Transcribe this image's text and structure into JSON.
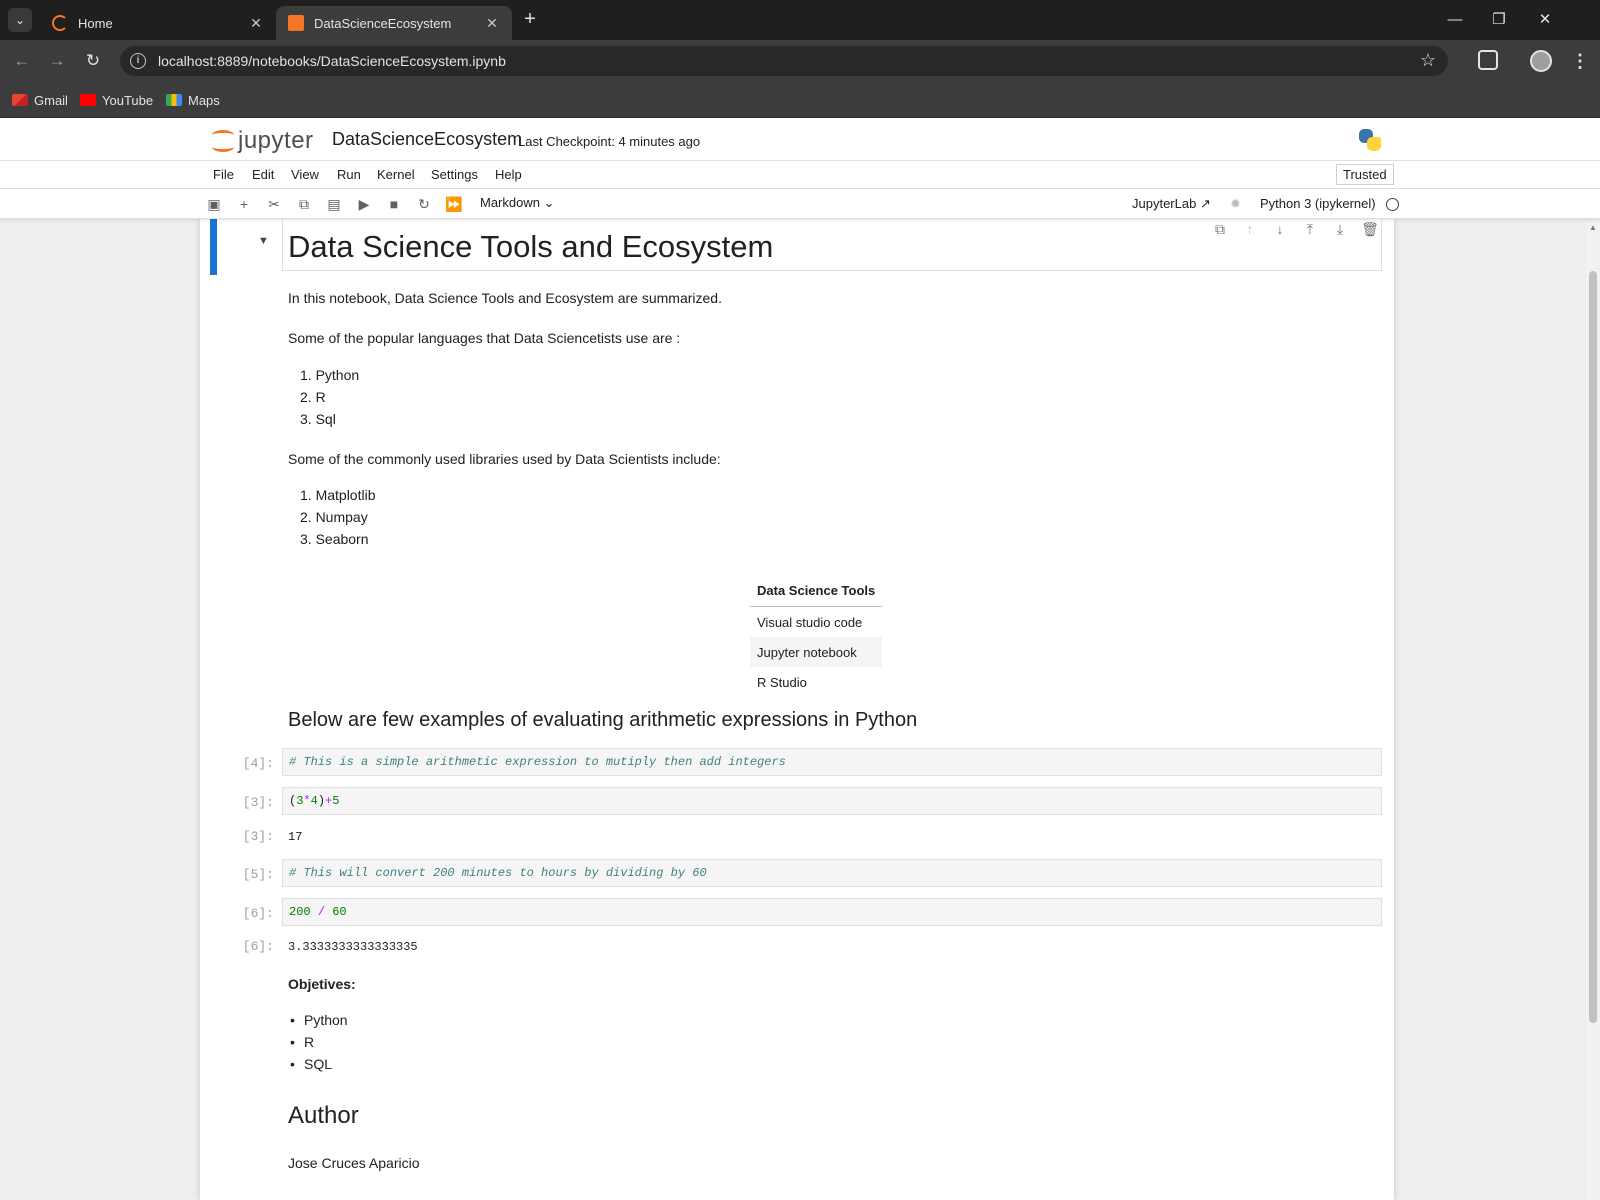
{
  "browser": {
    "tabs": [
      {
        "title": "Home",
        "active": false
      },
      {
        "title": "DataScienceEcosystem",
        "active": true
      }
    ],
    "url": "localhost:8889/notebooks/DataScienceEcosystem.ipynb",
    "bookmarks": [
      "Gmail",
      "YouTube",
      "Maps"
    ]
  },
  "jupyter": {
    "logo_text": "jupyter",
    "notebook_title": "DataScienceEcosystem",
    "checkpoint": "Last Checkpoint: 4 minutes ago",
    "menu": [
      "File",
      "Edit",
      "View",
      "Run",
      "Kernel",
      "Settings",
      "Help"
    ],
    "trusted": "Trusted",
    "cell_type": "Markdown",
    "jupyterlab_link": "JupyterLab",
    "kernel": "Python 3 (ipykernel)"
  },
  "notebook": {
    "title": "Data Science Tools and Ecosystem",
    "intro": "In this notebook, Data Science Tools and Ecosystem are summarized.",
    "languages_intro": "Some of the popular languages that Data Sciencetists use are :",
    "languages": [
      "1. Python",
      "2. R",
      "3. Sql"
    ],
    "libraries_intro": "Some of the commonly used libraries used by Data Scientists include:",
    "libraries": [
      "1. Matplotlib",
      "2. Numpay",
      "3. Seaborn"
    ],
    "tools_table": {
      "header": "Data Science Tools",
      "rows": [
        "Visual studio code",
        "Jupyter notebook",
        "R Studio"
      ]
    },
    "arith_heading": "Below are few examples of evaluating arithmetic expressions in Python",
    "cells": [
      {
        "prompt": "[4]:",
        "code": "# This is a simple arithmetic expression to mutiply then add integers"
      },
      {
        "prompt": "[3]:",
        "code": "(3*4)+5"
      },
      {
        "prompt": "[3]:",
        "output": "17"
      },
      {
        "prompt": "[5]:",
        "code": "# This will convert 200 minutes to hours by dividing by 60"
      },
      {
        "prompt": "[6]:",
        "code": "200 / 60"
      },
      {
        "prompt": "[6]:",
        "output": "3.3333333333333335"
      }
    ],
    "objectives_label": "Objetives:",
    "objectives": [
      "Python",
      "R",
      "SQL"
    ],
    "author_heading": "Author",
    "author_name": "Jose Cruces Aparicio"
  },
  "colors": {
    "jupyter_orange": "#f37726",
    "active_cell_blue": "#1976d2",
    "comment_teal": "#408080",
    "number_green": "#008000",
    "operator_purple": "#aa22ff"
  }
}
